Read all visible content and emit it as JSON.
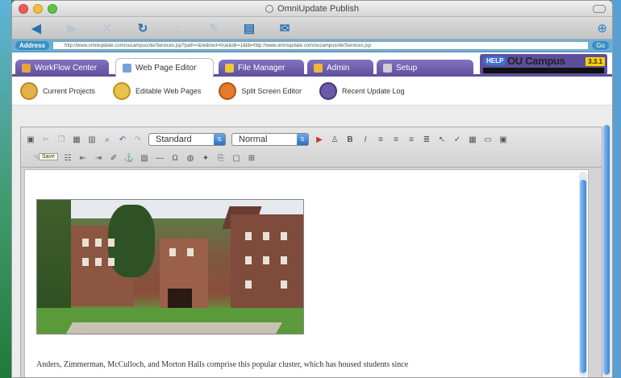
{
  "window": {
    "title": "OmniUpdate Publish",
    "traffic_colors": [
      "#ee5b52",
      "#f5bd3a",
      "#5bc442"
    ]
  },
  "browser": {
    "toolbar_icons": [
      "back-arrow-icon",
      "forward-arrow-icon",
      "stop-icon",
      "reload-icon",
      "home-icon",
      "bookmark-icon",
      "print-icon",
      "mail-icon",
      "help-icon"
    ],
    "address_label": "Address",
    "address_url": "http://www.omniupdate.com/oucampus/de/Services.jsp?path=/&redirect=true&dir=1&lib=http://www.omniupdate.com/oucampus/de/Services.jsp",
    "go_label": "Go"
  },
  "tabs": [
    {
      "label": "WorkFlow Center",
      "icon": "workflow-icon",
      "color": "#e9a33b"
    },
    {
      "label": "Web Page Editor",
      "icon": "page-editor-icon",
      "color": "#7aa0d8",
      "active": true
    },
    {
      "label": "File Manager",
      "icon": "folder-icon",
      "color": "#f0c63a"
    },
    {
      "label": "Admin",
      "icon": "admin-icon",
      "color": "#f2b440"
    },
    {
      "label": "Setup",
      "icon": "setup-icon",
      "color": "#cfcfcf"
    }
  ],
  "brand": {
    "help": "HELP",
    "name": "OU Campus",
    "version": "3.3.1"
  },
  "subnav": [
    {
      "label": "Current Projects"
    },
    {
      "label": "Editable Web Pages"
    },
    {
      "label": "Split Screen Editor"
    },
    {
      "label": "Recent Update Log"
    }
  ],
  "editor": {
    "style_select": "Standard",
    "format_select": "Normal",
    "tooltip": "Save",
    "caption": "Anders, Zimmerman, McCulloch, and Morton Halls comprise this popular cluster, which has housed students since"
  },
  "colors": {
    "accent_purple": "#5d4f9c",
    "address_blue": "#6bb0d8",
    "scroll_blue": "#3a86d4"
  }
}
